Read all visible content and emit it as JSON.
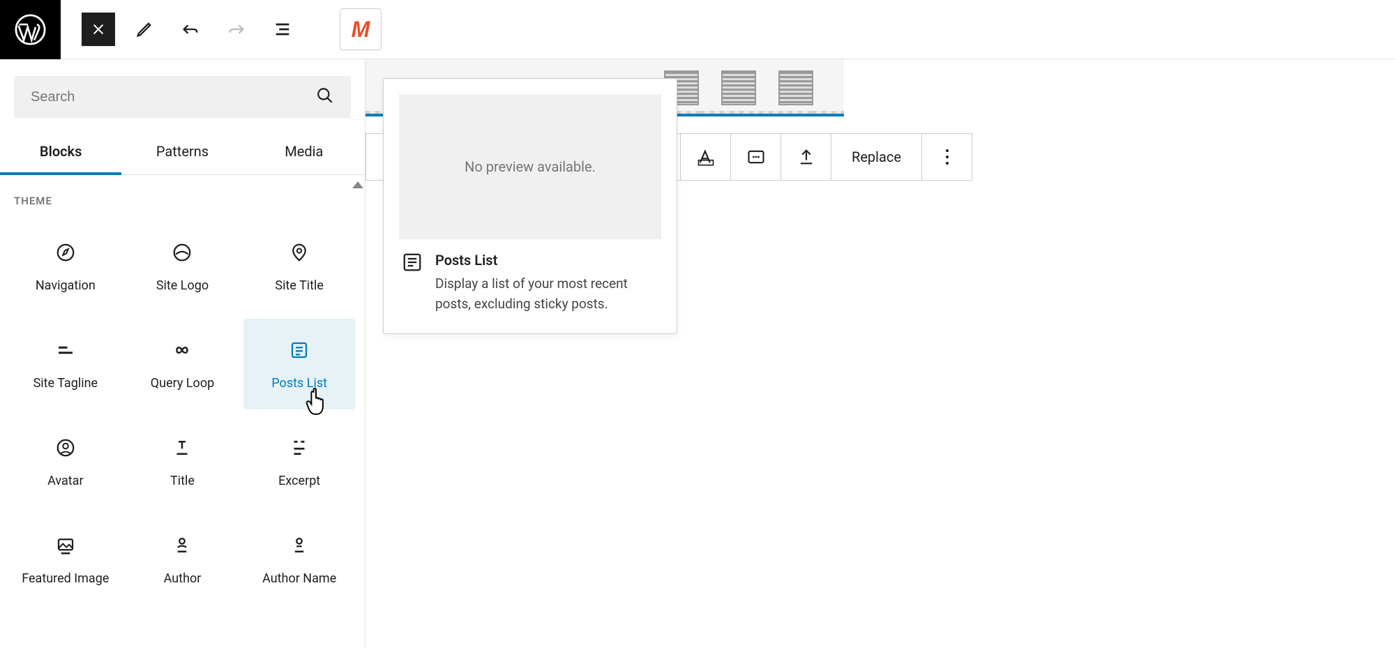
{
  "accent": "#007cba",
  "toolbar": {
    "replace_label": "Replace"
  },
  "search": {
    "placeholder": "Search"
  },
  "sidebar_tabs": {
    "blocks": "Blocks",
    "patterns": "Patterns",
    "media": "Media"
  },
  "theme_section_label": "THEME",
  "preview": {
    "no_preview": "No preview available.",
    "title": "Posts List",
    "description": "Display a list of your most recent posts, excluding sticky posts."
  },
  "blocks": [
    {
      "label": "Navigation"
    },
    {
      "label": "Site Logo"
    },
    {
      "label": "Site Title"
    },
    {
      "label": "Site Tagline"
    },
    {
      "label": "Query Loop"
    },
    {
      "label": "Posts List"
    },
    {
      "label": "Avatar"
    },
    {
      "label": "Title"
    },
    {
      "label": "Excerpt"
    },
    {
      "label": "Featured Image"
    },
    {
      "label": "Author"
    },
    {
      "label": "Author Name"
    }
  ]
}
